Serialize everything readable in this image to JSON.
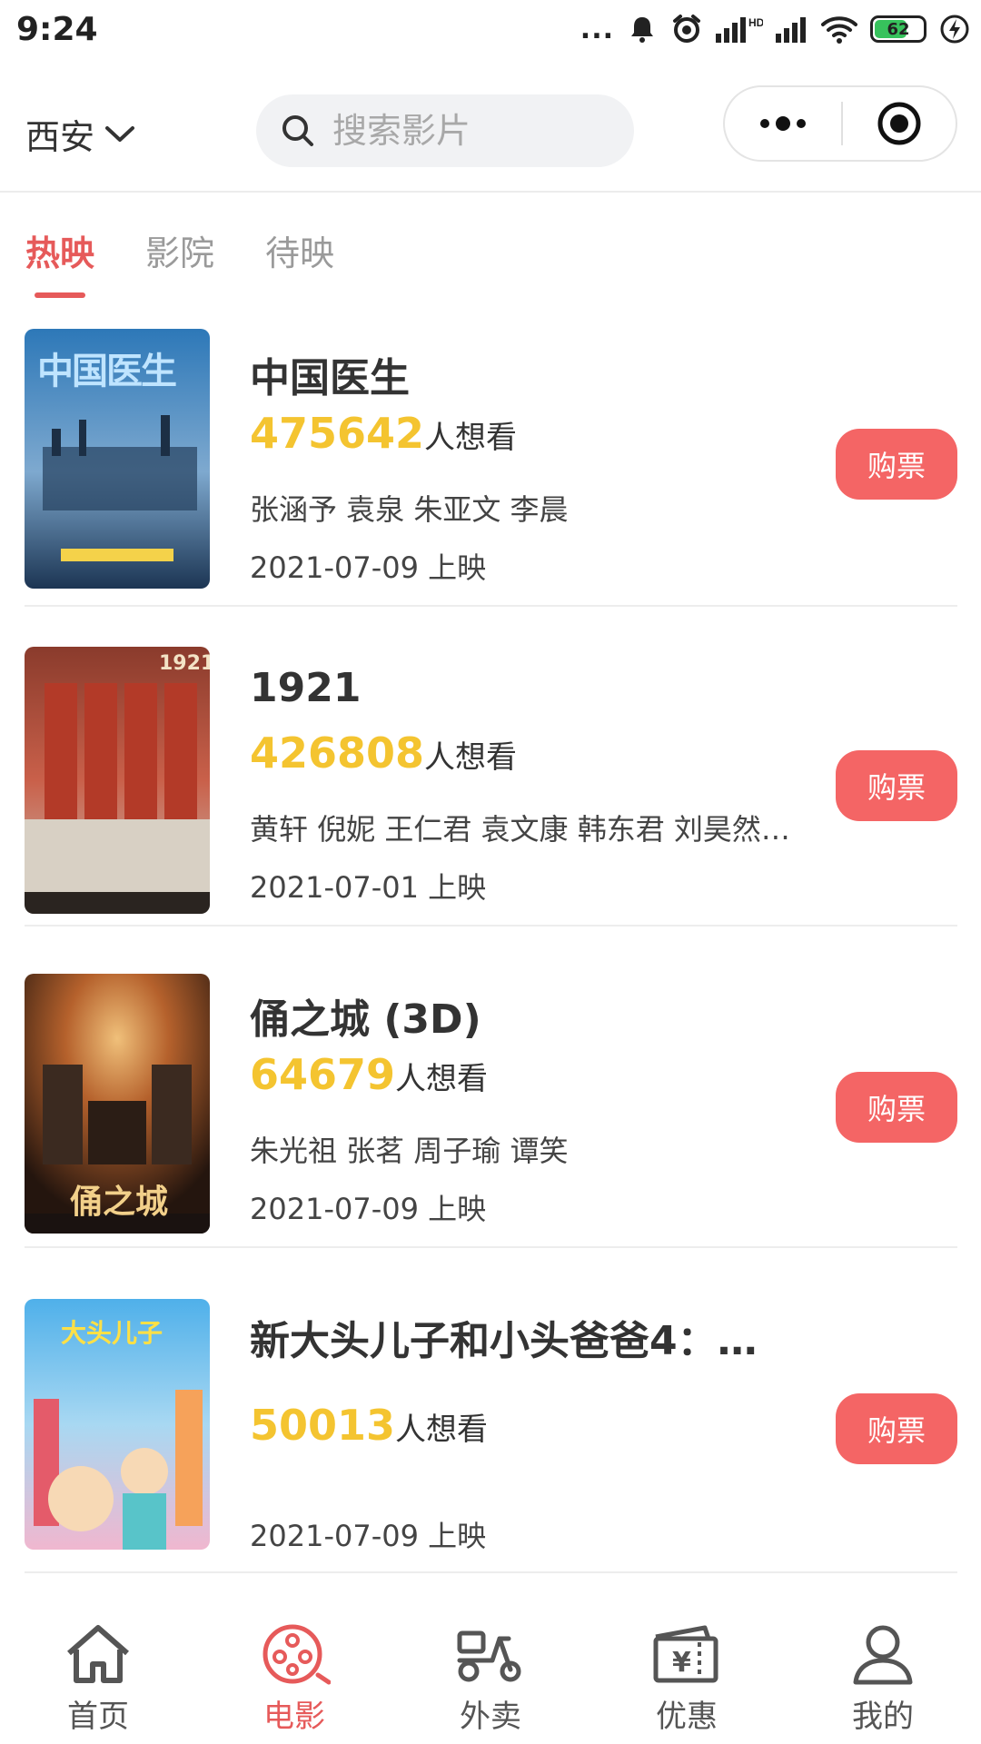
{
  "status": {
    "time": "9:24",
    "battery": "62",
    "dots": "..."
  },
  "header": {
    "city": "西安",
    "search_placeholder": "搜索影片"
  },
  "tabs": [
    {
      "label": "热映"
    },
    {
      "label": "影院"
    },
    {
      "label": "待映"
    }
  ],
  "movies": [
    {
      "title": "中国医生",
      "want_count": "475642",
      "want_suffix": "人想看",
      "cast": "张涵予 袁泉 朱亚文 李晨",
      "release": "2021-07-09 上映",
      "buy_label": "购票",
      "poster_text": "中国医生",
      "poster_colors": [
        "#1f5f9a",
        "#5a8fbf",
        "#203a5a"
      ]
    },
    {
      "title": "1921",
      "want_count": "426808",
      "want_suffix": "人想看",
      "cast": "黄轩 倪妮 王仁君 袁文康 韩东君 刘昊然…",
      "release": "2021-07-01 上映",
      "buy_label": "购票",
      "poster_text": "1921",
      "poster_colors": [
        "#b94a35",
        "#d9cfc0",
        "#5b5046"
      ]
    },
    {
      "title": "俑之城 (3D)",
      "want_count": "64679",
      "want_suffix": "人想看",
      "cast": "朱光祖 张茗 周子瑜 谭笑",
      "release": "2021-07-09 上映",
      "buy_label": "购票",
      "poster_text": "俑之城",
      "poster_colors": [
        "#c77a3a",
        "#5b3a25",
        "#2a1c14"
      ]
    },
    {
      "title": "新大头儿子和小头爸爸4：…",
      "want_count": "50013",
      "want_suffix": "人想看",
      "cast": "",
      "release": "2021-07-09 上映",
      "buy_label": "购票",
      "poster_text": "大头儿子",
      "poster_colors": [
        "#58b4ea",
        "#f29bc0",
        "#f6d35a"
      ]
    }
  ],
  "bottom_nav": [
    {
      "label": "首页",
      "icon": "home-icon"
    },
    {
      "label": "电影",
      "icon": "film-reel-icon"
    },
    {
      "label": "外卖",
      "icon": "scooter-icon"
    },
    {
      "label": "优惠",
      "icon": "coupon-icon"
    },
    {
      "label": "我的",
      "icon": "user-icon"
    }
  ],
  "colors": {
    "accent": "#e65a5a",
    "buy_button": "#f46565",
    "want_number": "#f4c430"
  }
}
